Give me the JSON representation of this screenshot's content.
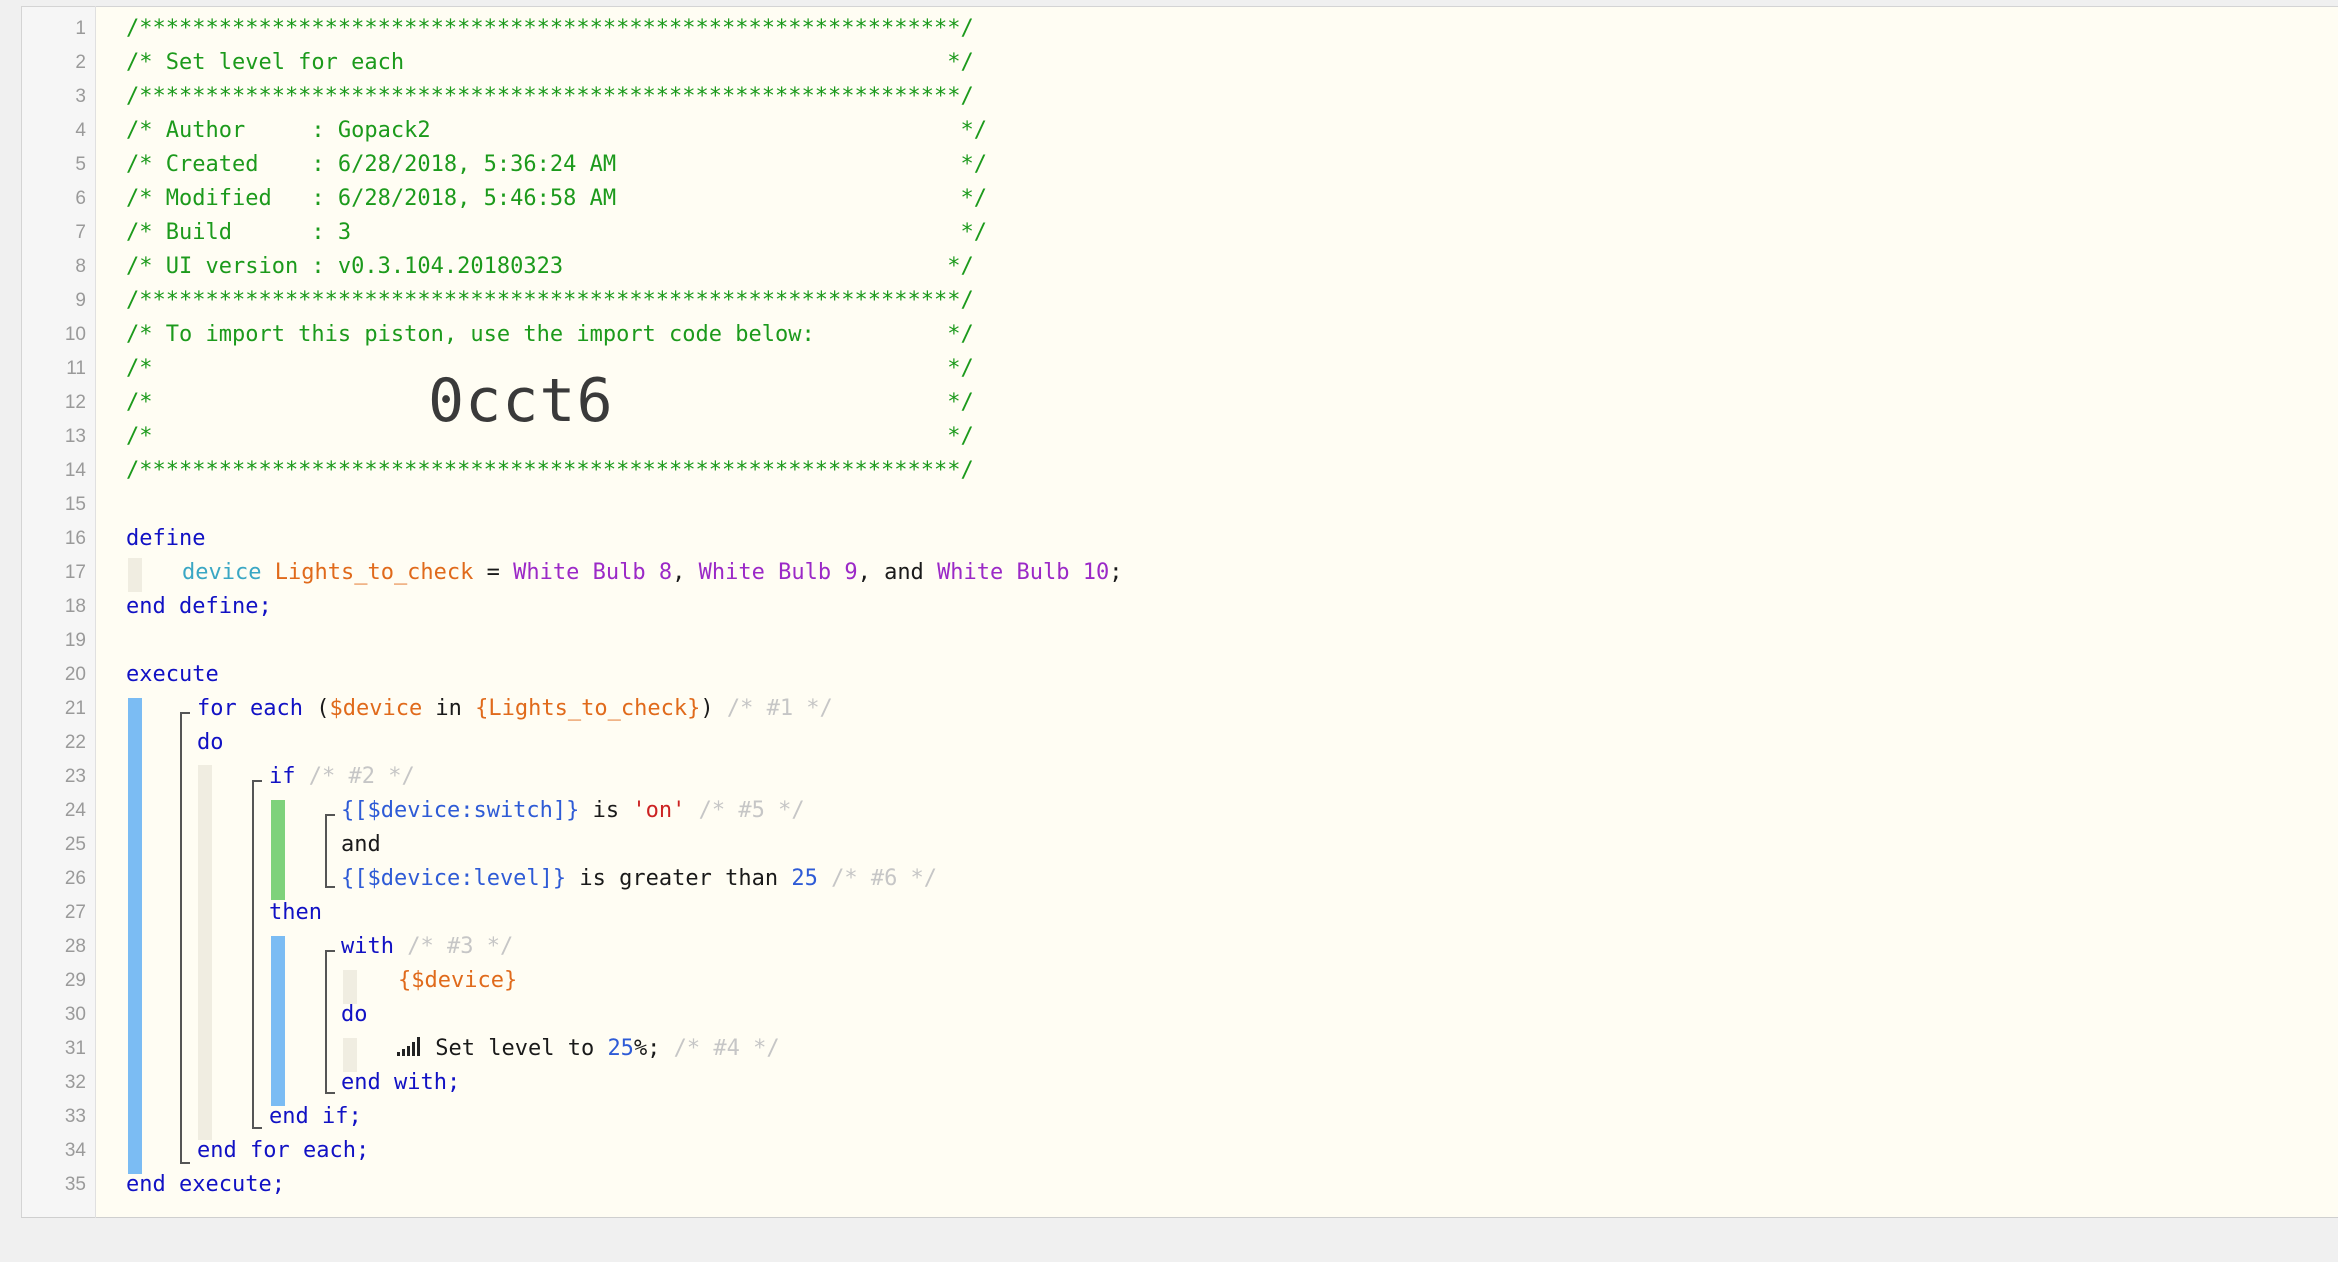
{
  "editor": {
    "line_numbers": [
      "1",
      "2",
      "3",
      "4",
      "5",
      "6",
      "7",
      "8",
      "9",
      "10",
      "11",
      "12",
      "13",
      "14",
      "15",
      "16",
      "17",
      "18",
      "19",
      "20",
      "21",
      "22",
      "23",
      "24",
      "25",
      "26",
      "27",
      "28",
      "29",
      "30",
      "31",
      "32",
      "33",
      "34",
      "35"
    ],
    "header": {
      "stars": "/**************************************************************/",
      "title": "/* Set level for each                                         */",
      "author": "/* Author     : Gopack2                                        */",
      "created": "/* Created    : 6/28/2018, 5:36:24 AM                          */",
      "modified": "/* Modified   : 6/28/2018, 5:46:58 AM                          */",
      "build": "/* Build      : 3                                              */",
      "ui_version": "/* UI version : v0.3.104.20180323                             */",
      "import_note": "/* To import this piston, use the import code below:          */",
      "blank": "/*                                                            */",
      "import_code_line": "/*                                                            */",
      "import_code": "0cct6"
    },
    "code": {
      "define": "define",
      "device_kw": "device",
      "var_name": "Lights_to_check",
      "equals": " = ",
      "dev1": "White Bulb 8",
      "comma1": ", ",
      "dev2": "White Bulb 9",
      "and_sep": ", and ",
      "dev3": "White Bulb 10",
      "semi": ";",
      "end_define": "end define;",
      "execute": "execute",
      "for_each": "for each",
      "open_paren": " (",
      "loop_var": "$device",
      "in_kw": " in ",
      "loop_list": "{Lights_to_check}",
      "close_paren": ")",
      "cmt1": " /* #1 */",
      "do1": "do",
      "if_kw": "if",
      "cmt2": " /* #2 */",
      "cond1_expr": "{[$device:switch]}",
      "cond1_is": " is ",
      "cond1_val": "'on'",
      "cmt5": " /* #5 */",
      "and_kw": "and",
      "cond2_expr": "{[$device:level]}",
      "cond2_op": " is greater than ",
      "cond2_val": "25",
      "cmt6": " /* #6 */",
      "then_kw": "then",
      "with_kw": "with",
      "cmt3": " /* #3 */",
      "with_dev": "{$device}",
      "do2": "do",
      "action_text": " Set level to ",
      "action_val": "25",
      "action_end": "%;",
      "cmt4": " /* #4 */",
      "end_with": "end with;",
      "end_if": "end if;",
      "end_for_each": "end for each;",
      "end_execute": "end execute;"
    },
    "colors": {
      "comment": "#1c9a1c",
      "keyword": "#1111c4",
      "variable": "#e06a1b",
      "device": "#9b29c7",
      "number": "#2e5bd6",
      "string": "#cc2222",
      "block_blue": "#7bbcf3",
      "block_green": "#7ed27b"
    }
  }
}
